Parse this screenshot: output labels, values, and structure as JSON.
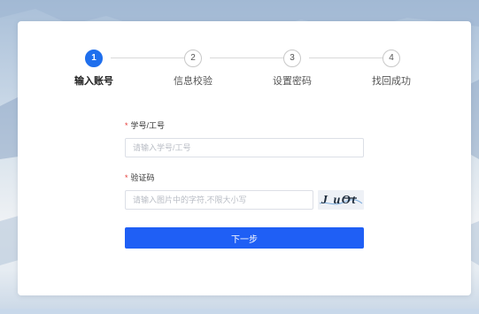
{
  "steps": [
    {
      "number": "1",
      "label": "输入账号",
      "state": "active"
    },
    {
      "number": "2",
      "label": "信息校验",
      "state": "pending"
    },
    {
      "number": "3",
      "label": "设置密码",
      "state": "pending"
    },
    {
      "number": "4",
      "label": "找回成功",
      "state": "pending"
    }
  ],
  "form": {
    "required_mark": "*",
    "account": {
      "label": "学号/工号",
      "placeholder": "请输入学号/工号",
      "value": ""
    },
    "captcha": {
      "label": "验证码",
      "placeholder": "请输入图片中的字符,不限大小写",
      "value": "",
      "image_text": "JuOt"
    },
    "submit_label": "下一步"
  },
  "colors": {
    "accent": "#1f5ff5",
    "step_active": "#1f6fed",
    "required": "#e53935"
  }
}
